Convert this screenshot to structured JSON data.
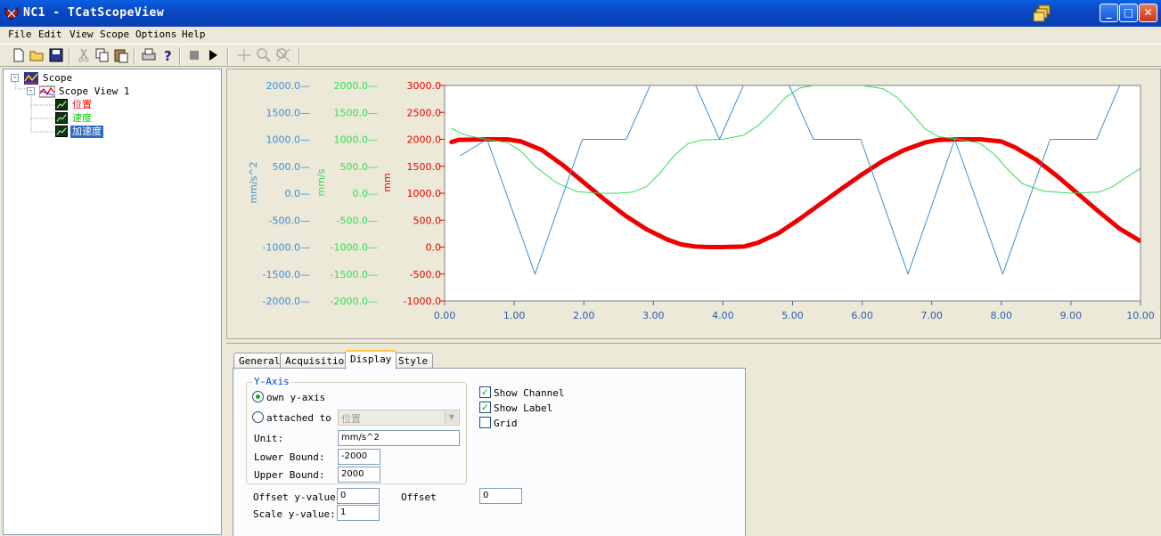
{
  "window": {
    "title": "NC1 - TCatScopeView"
  },
  "menu": [
    "File",
    "Edit",
    "View",
    "Scope",
    "Options",
    "Help"
  ],
  "tree": {
    "root": "Scope",
    "view": "Scope View 1",
    "channels": [
      {
        "label": "位置",
        "color": "#ff0000",
        "selected": false
      },
      {
        "label": "速度",
        "color": "#00cc00",
        "selected": false
      },
      {
        "label": "加速度",
        "color": "#ffffff",
        "selected": true
      }
    ]
  },
  "colors": {
    "acc": "#3a8fd8",
    "vel": "#33dd55",
    "pos": "#ee0000"
  },
  "axes": {
    "acc": {
      "unit": "mm/s^2",
      "ticks": [
        "2000.0",
        "1500.0",
        "1000.0",
        "500.0",
        "0.0",
        "-500.0",
        "-1000.0",
        "-1500.0",
        "-2000.0"
      ]
    },
    "vel": {
      "unit": "mm/s",
      "ticks": [
        "2000.0",
        "1500.0",
        "1000.0",
        "500.0",
        "0.0",
        "-500.0",
        "-1000.0",
        "-1500.0",
        "-2000.0"
      ]
    },
    "pos": {
      "unit": "mm",
      "ticks": [
        "3000.0",
        "2500.0",
        "2000.0",
        "1500.0",
        "1000.0",
        "500.0",
        "0.0",
        "-500.0",
        "-1000.0"
      ]
    },
    "x": {
      "ticks": [
        "0.00",
        "1.00",
        "2.00",
        "3.00",
        "4.00",
        "5.00",
        "6.00",
        "7.00",
        "8.00",
        "9.00",
        "10.00"
      ]
    }
  },
  "chart_data": {
    "type": "line",
    "x_range": [
      0,
      10
    ],
    "series": [
      {
        "axis": "pos",
        "ylim": [
          -1000,
          3000
        ],
        "width": 5,
        "x": [
          0.1,
          0.2,
          0.6,
          0.9,
          1.1,
          1.4,
          1.7,
          2.0,
          2.3,
          2.6,
          2.9,
          3.2,
          3.4,
          3.6,
          3.8,
          4.0,
          4.3,
          4.5,
          4.8,
          5.1,
          5.4,
          5.7,
          6.0,
          6.3,
          6.6,
          6.9,
          7.1,
          7.4,
          7.7,
          8.0,
          8.2,
          8.5,
          8.8,
          9.1,
          9.4,
          9.7,
          10.0
        ],
        "y": [
          1950,
          1990,
          2000,
          2000,
          1960,
          1800,
          1520,
          1200,
          880,
          580,
          330,
          140,
          50,
          10,
          0,
          0,
          10,
          80,
          260,
          520,
          800,
          1080,
          1350,
          1600,
          1800,
          1940,
          1990,
          2000,
          2000,
          1960,
          1850,
          1620,
          1320,
          990,
          660,
          340,
          110
        ]
      },
      {
        "axis": "vel",
        "ylim": [
          -2000,
          2000
        ],
        "width": 1,
        "x": [
          0.1,
          0.3,
          0.6,
          0.9,
          1.1,
          1.3,
          1.6,
          1.9,
          2.2,
          2.5,
          2.7,
          2.9,
          3.1,
          3.3,
          3.5,
          3.7,
          4.0,
          4.3,
          4.5,
          4.7,
          4.9,
          5.1,
          5.3,
          5.6,
          6.0,
          6.3,
          6.5,
          6.7,
          6.9,
          7.1,
          7.4,
          7.7,
          7.9,
          8.1,
          8.3,
          8.6,
          9.0,
          9.4,
          9.6,
          9.8,
          10.0
        ],
        "y": [
          1200,
          1080,
          1000,
          940,
          780,
          500,
          200,
          30,
          0,
          0,
          20,
          120,
          380,
          700,
          920,
          990,
          1000,
          1080,
          1250,
          1500,
          1780,
          1950,
          2000,
          2000,
          2000,
          1940,
          1780,
          1500,
          1200,
          1050,
          1000,
          920,
          720,
          430,
          180,
          40,
          0,
          20,
          120,
          300,
          460
        ]
      },
      {
        "axis": "acc",
        "ylim": [
          -2000,
          2000
        ],
        "width": 1,
        "x": [
          0.23,
          0.61,
          1.3,
          1.98,
          2.61,
          3.28,
          3.95,
          4.62,
          5.3,
          5.98,
          6.66,
          7.33,
          8.02,
          8.7,
          9.37,
          10.0
        ],
        "y": [
          700,
          1000,
          -1500,
          1000,
          1000,
          2950,
          1000,
          2950,
          1000,
          1000,
          -1500,
          1000,
          -1500,
          1000,
          1000,
          2900
        ]
      }
    ]
  },
  "tabs": [
    "General",
    "Acquisition",
    "Display",
    "Style"
  ],
  "display": {
    "group_title": "Y-Axis",
    "own_axis": "own y-axis",
    "attached_to": "attached to",
    "attached_value": "位置",
    "unit_label": "Unit:",
    "unit_value": "mm/s^2",
    "lower_label": "Lower Bound:",
    "lower_value": "-2000",
    "upper_label": "Upper Bound:",
    "upper_value": "2000",
    "offset_y_label": "Offset y-value:",
    "offset_y_value": "0",
    "offset_label": "Offset",
    "offset_value": "0",
    "scale_y_label": "Scale y-value:",
    "scale_y_value": "1",
    "show_channel": "Show Channel",
    "show_label": "Show Label",
    "grid": "Grid"
  }
}
